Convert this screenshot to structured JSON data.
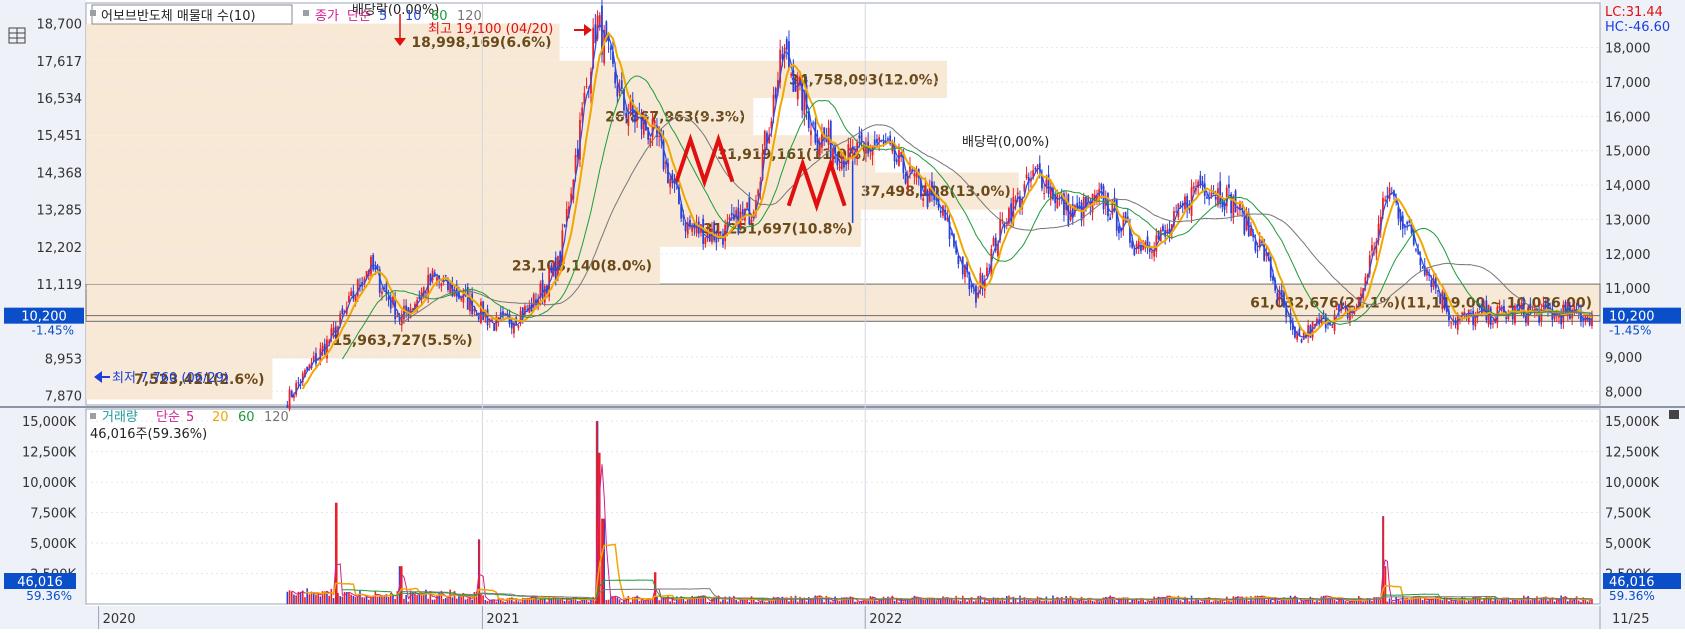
{
  "colors": {
    "up": "#e8202a",
    "down": "#2b3fd6",
    "ma5": "#2a4de0",
    "ma20": "#f0a800",
    "ma60": "#1e9a3a",
    "ma120": "#777777",
    "box": "#f7e7d3",
    "price_tag": "#0a4ec9",
    "red_marker": "#e01010",
    "blue_marker": "#1a3ee0"
  },
  "chart_data": [
    {
      "type": "candlestick",
      "legend": {
        "title": "어보브반도체 매물대 수(10)",
        "items": [
          "종가",
          "단순",
          "5",
          "10",
          "60",
          "120"
        ]
      },
      "dividend_label": "배당락(0.00%)",
      "dividend_label_2": "배당락(0,00%)",
      "high_label": "최고 19,100 (04/20)",
      "low_label": "최저 7,760 (06/29)",
      "current_price": "10,200",
      "change_pct": "-1.45%",
      "lc": "LC:31.44",
      "hc": "HC:-46.60",
      "yaxis_left": [
        "18,700",
        "17,617",
        "16,534",
        "15,451",
        "14,368",
        "13,285",
        "12,202",
        "11,119",
        "8,953",
        "7,870"
      ],
      "yaxis_right": [
        "18,000",
        "17,000",
        "16,000",
        "15,000",
        "14,000",
        "13,000",
        "12,000",
        "11,000",
        "9,000",
        "8,000"
      ],
      "ylim": [
        7600,
        19300
      ],
      "x_labels": [
        "2020",
        "2021",
        "2022",
        "11/25"
      ],
      "series_ma": [
        {
          "name": "5"
        },
        {
          "name": "10"
        },
        {
          "name": "60"
        },
        {
          "name": "120"
        }
      ],
      "close_points": [
        [
          "2020-06-29",
          7760
        ],
        [
          "2020-08",
          9800
        ],
        [
          "2020-09",
          11700
        ],
        [
          "2020-10",
          10100
        ],
        [
          "2020-11",
          11300
        ],
        [
          "2020-12",
          10700
        ],
        [
          "2021-01",
          9900
        ],
        [
          "2021-02",
          10400
        ],
        [
          "2021-03",
          11700
        ],
        [
          "2021-04-20",
          18800
        ],
        [
          "2021-05",
          16300
        ],
        [
          "2021-06",
          15400
        ],
        [
          "2021-07",
          12800
        ],
        [
          "2021-08",
          12500
        ],
        [
          "2021-09",
          13300
        ],
        [
          "2021-10",
          17900
        ],
        [
          "2021-11",
          15500
        ],
        [
          "2021-12",
          14800
        ],
        [
          "2022-01",
          15200
        ],
        [
          "2022-02",
          14200
        ],
        [
          "2022-03",
          13200
        ],
        [
          "2022-04",
          10700
        ],
        [
          "2022-05",
          13100
        ],
        [
          "2022-06",
          14400
        ],
        [
          "2022-07",
          13100
        ],
        [
          "2022-08",
          13600
        ],
        [
          "2022-09",
          12300
        ],
        [
          "2022-10",
          12500
        ],
        [
          "2022-11",
          14100
        ],
        [
          "2022-12",
          13600
        ],
        [
          "2023-01",
          12100
        ],
        [
          "2023-02",
          9400
        ],
        [
          "2023-03",
          10100
        ],
        [
          "2023-04",
          10400
        ],
        [
          "2023-05",
          13900
        ],
        [
          "2023-06",
          11900
        ],
        [
          "2023-07",
          10100
        ],
        [
          "2023-08",
          10200
        ],
        [
          "2023-09",
          10300
        ],
        [
          "2023-11-25",
          10200
        ]
      ],
      "volume_profile": [
        {
          "price_low": 7760,
          "price_high": 8953,
          "label": "7,523,421(2.6%)",
          "pct": 2.6
        },
        {
          "price_low": 8953,
          "price_high": 10036,
          "label": "15,963,727(5.5%)",
          "pct": 5.5
        },
        {
          "price_low": 10036,
          "price_high": 11119,
          "label": "61,032,676(21.1%)(11,119.00 ~ 10,036.00)",
          "pct": 21.1
        },
        {
          "price_low": 11119,
          "price_high": 12202,
          "label": "23,108,140(8.0%)",
          "pct": 8.0
        },
        {
          "price_low": 12202,
          "price_high": 13285,
          "label": "31,251,697(10.8%)",
          "pct": 10.8
        },
        {
          "price_low": 13285,
          "price_high": 14368,
          "label": "37,498,108(13.0%)",
          "pct": 13.0
        },
        {
          "price_low": 14368,
          "price_high": 15451,
          "label": "31,919,161(11.0%)",
          "pct": 11.0
        },
        {
          "price_low": 15451,
          "price_high": 16534,
          "label": "26,867,963(9.3%)",
          "pct": 9.3
        },
        {
          "price_low": 16534,
          "price_high": 17617,
          "label": "34,758,093(12.0%)",
          "pct": 12.0
        },
        {
          "price_low": 17617,
          "price_high": 18700,
          "label": "18,998,169(6.6%)",
          "pct": 6.6
        }
      ]
    },
    {
      "type": "bar",
      "legend": {
        "items": [
          "거래량",
          "단순",
          "5",
          "20",
          "60",
          "120"
        ]
      },
      "current_label": "46,016주(59.36%)",
      "current_value": "46,016",
      "current_pct": "59.36%",
      "yaxis": [
        "15,000K",
        "12,500K",
        "10,000K",
        "7,500K",
        "5,000K",
        "2,500K"
      ],
      "ylim": [
        0,
        15500
      ],
      "spikes_k": [
        [
          "2020-08",
          8300
        ],
        [
          "2020-10",
          3100
        ],
        [
          "2020-12-29",
          5300
        ],
        [
          "2021-04-20",
          15000
        ],
        [
          "2021-04-22",
          12400
        ],
        [
          "2021-04-26",
          7000
        ],
        [
          "2021-06",
          2600
        ],
        [
          "2023-05-10",
          7200
        ],
        [
          "2023-05-12",
          3100
        ]
      ]
    }
  ]
}
